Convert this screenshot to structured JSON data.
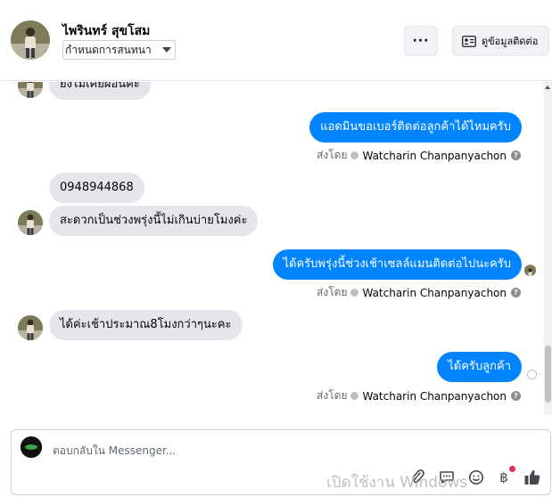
{
  "header": {
    "contact_name": "ไพรินทร์ สุขโสม",
    "topic_select": "กำหนดการสนทนา",
    "more_label": "···",
    "info_button": "ดูข้อมูลติดต่อ"
  },
  "messages": [
    {
      "id": "m0",
      "direction": "in",
      "text": "ยังไม่เคยผ่อนค่ะ"
    },
    {
      "id": "m1",
      "direction": "out",
      "text": "แอดมินขอเบอร์ติดต่อลูกค้าได้ไหมครับ"
    },
    {
      "id": "m2",
      "direction": "in",
      "text": "0948944868"
    },
    {
      "id": "m3",
      "direction": "in",
      "text": "สะดวกเป็นช่วงพรุ่งนี้ไม่เกินบ่ายโมงค่ะ"
    },
    {
      "id": "m4",
      "direction": "out",
      "text": "ได้ครับพรุ่งนี้ช่วงเช้าเซลล์แมนติดต่อไปนะครับ"
    },
    {
      "id": "m5",
      "direction": "in",
      "text": "ได้ค่ะเช้าประมาณ8โมงกว่าๆนะคะ"
    },
    {
      "id": "m6",
      "direction": "out",
      "text": "ได้ครับลูกค้า"
    }
  ],
  "sent_by": {
    "prefix": "ส่งโดย",
    "name": "Watcharin Chanpanyachon",
    "help": "?"
  },
  "composer": {
    "placeholder": "ตอบกลับใน Messenger...",
    "currency_icon": "฿"
  },
  "watermark": "เปิดใช้งาน Windows",
  "icons": [
    "more-icon",
    "contact-card-icon",
    "attachment-icon",
    "saved-reply-icon",
    "emoji-icon",
    "payment-icon",
    "like-icon"
  ],
  "colors": {
    "outgoing_bubble": "#0084ff",
    "incoming_bubble": "#e4e6eb",
    "notification_dot": "#f02849"
  }
}
